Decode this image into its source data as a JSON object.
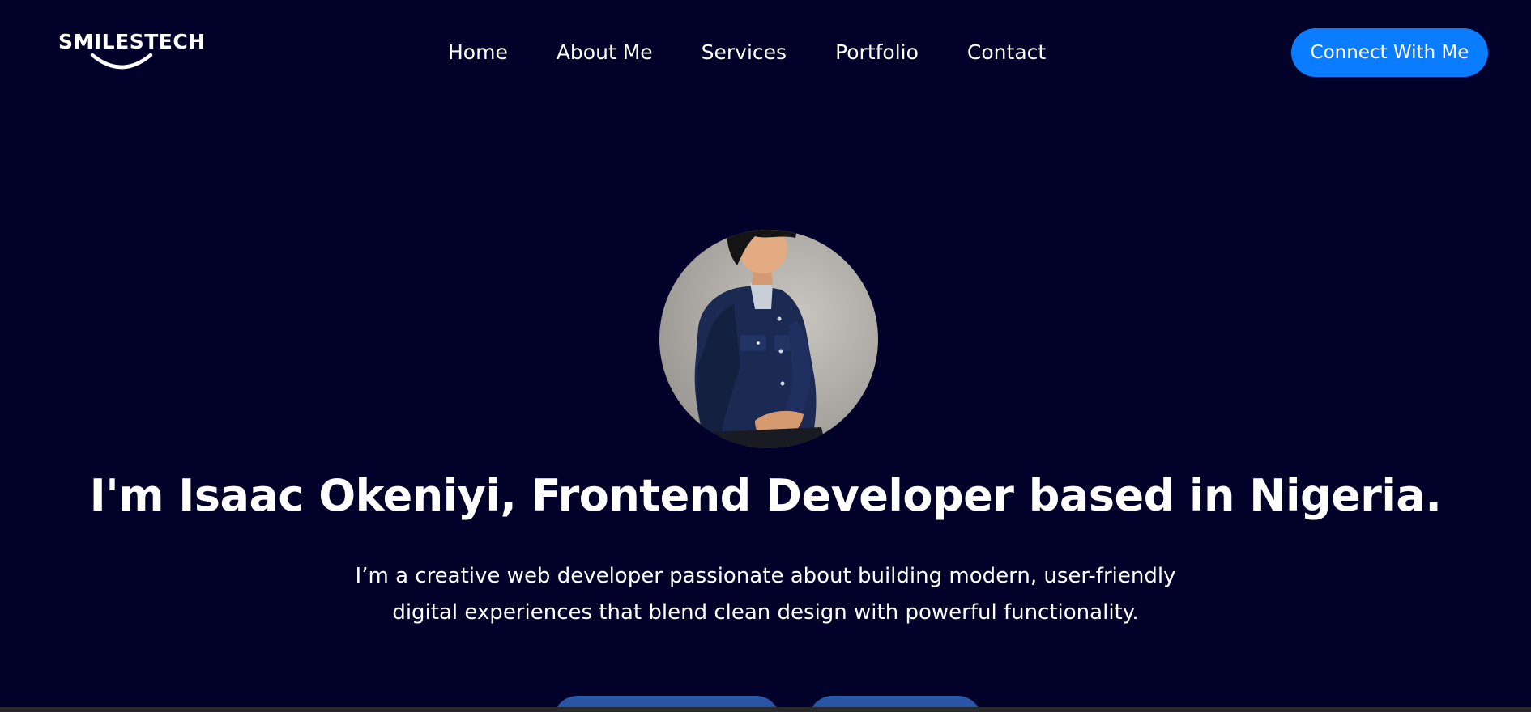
{
  "brand": {
    "logo_text": "SMILESTECH",
    "logo_icon": "smile-curve"
  },
  "nav": {
    "items": [
      {
        "label": "Home"
      },
      {
        "label": "About Me"
      },
      {
        "label": "Services"
      },
      {
        "label": "Portfolio"
      },
      {
        "label": "Contact"
      }
    ],
    "cta_label": "Connect With Me"
  },
  "hero": {
    "avatar_alt": "profile-illustration",
    "headline": "I'm Isaac Okeniyi, Frontend Developer based in Nigeria.",
    "intro_line1": "I’m a creative web developer passionate about building modern, user-friendly",
    "intro_line2": "digital experiences that blend clean design with powerful functionality."
  },
  "colors": {
    "background": "#02012a",
    "accent": "#0a7cff",
    "text": "#ffffff",
    "hero_button": "#2451a0"
  }
}
